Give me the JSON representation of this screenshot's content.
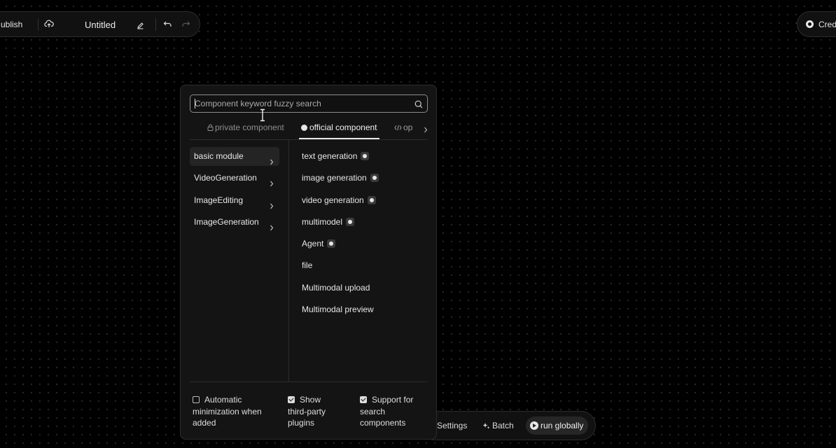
{
  "topbar": {
    "publish_label": "ublish",
    "title": "Untitled"
  },
  "credits": {
    "label": "Credi"
  },
  "bottombar": {
    "settings_label": "Settings",
    "batch_label": "Batch",
    "run_label": "run globally"
  },
  "panel": {
    "search_placeholder": "Component keyword fuzzy search",
    "tabs": [
      {
        "label": "private component",
        "icon": "lock-icon"
      },
      {
        "label": "official component",
        "icon": "official-icon"
      },
      {
        "label": "op",
        "icon": "code-icon"
      }
    ],
    "categories": [
      {
        "label": "basic module"
      },
      {
        "label": "VideoGeneration"
      },
      {
        "label": "ImageEditing"
      },
      {
        "label": "ImageGeneration"
      }
    ],
    "items": [
      {
        "label": "text generation"
      },
      {
        "label": "image generation"
      },
      {
        "label": "video generation"
      },
      {
        "label": "multimodel"
      },
      {
        "label": "Agent"
      },
      {
        "label": "file"
      },
      {
        "label": "Multimodal upload"
      },
      {
        "label": "Multimodal preview"
      }
    ],
    "options": [
      {
        "line1": "Automatic",
        "line2": "minimization when",
        "line3": "added",
        "checked": false
      },
      {
        "line1": "Show",
        "line2": "third-party",
        "line3": "plugins",
        "checked": true
      },
      {
        "line1": "Support for",
        "line2": "search",
        "line3": "components",
        "checked": true
      }
    ]
  }
}
